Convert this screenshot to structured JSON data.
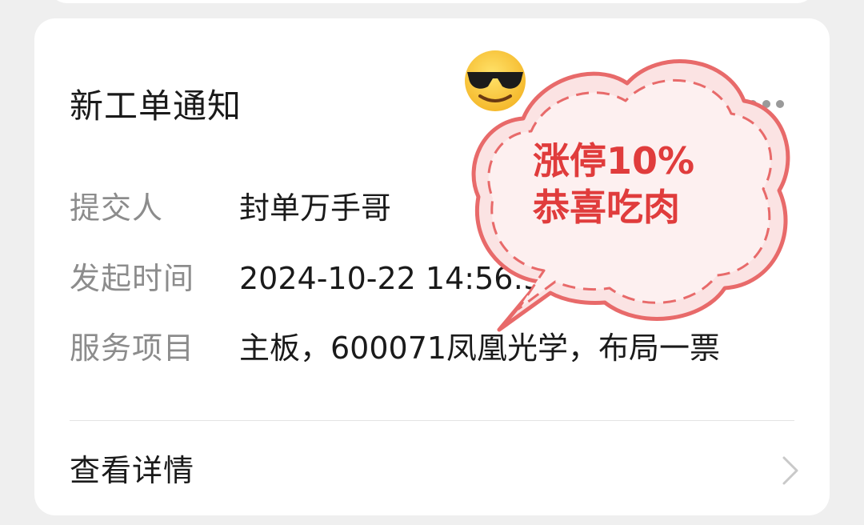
{
  "card": {
    "title": "新工单通知",
    "rows": [
      {
        "label": "提交人",
        "value": "封单万手哥"
      },
      {
        "label": "发起时间",
        "value": "2024-10-22 14:56:50"
      },
      {
        "label": "服务项目",
        "value": "主板，600071凤凰光学，布局一票"
      }
    ],
    "detail_link": "查看详情",
    "more_icon": "more-dots-icon",
    "chevron_icon": "chevron-right-icon"
  },
  "sticker": {
    "line1": "涨停10%",
    "line2": "恭喜吃肉",
    "emoji": "sunglasses-emoji-icon",
    "color": "#e03c3c"
  }
}
